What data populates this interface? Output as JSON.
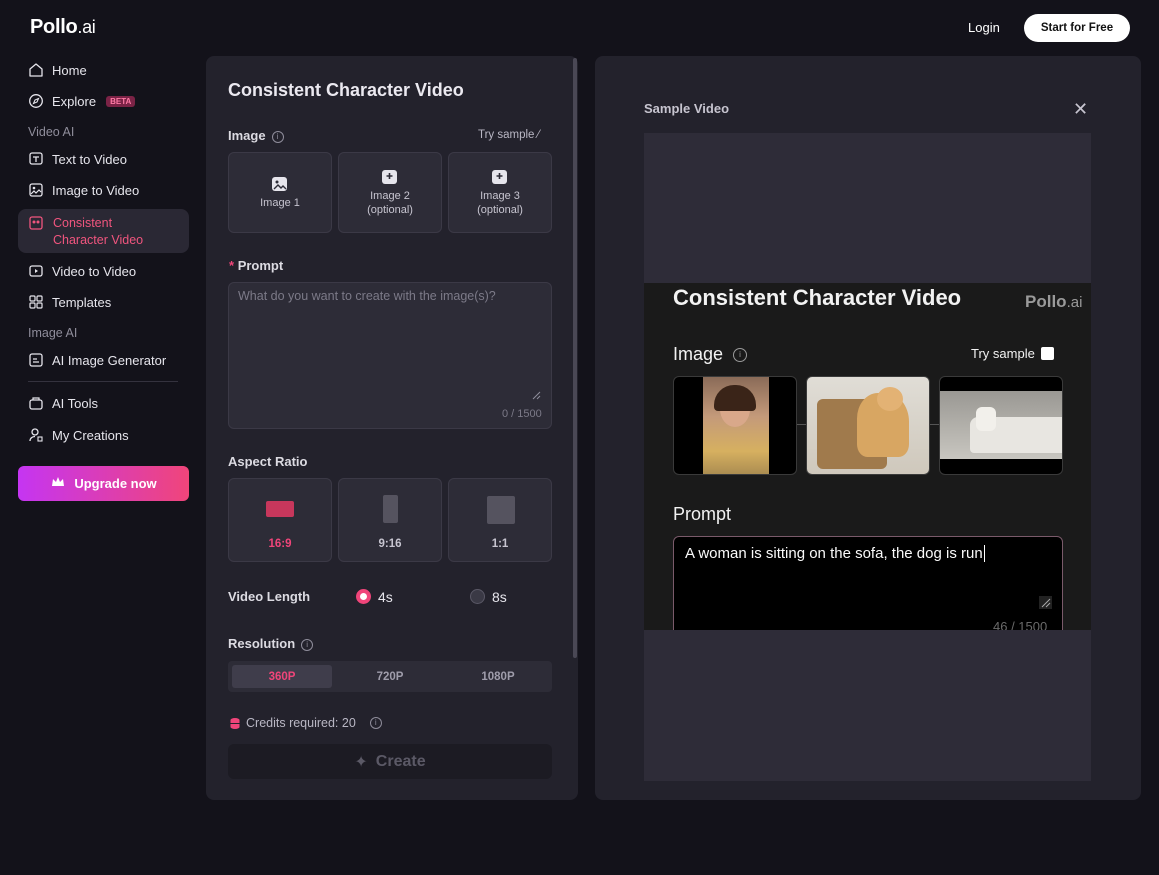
{
  "header": {
    "logo_main": "Pollo",
    "logo_ai": ".ai",
    "login": "Login",
    "start": "Start for Free"
  },
  "sidebar": {
    "home": "Home",
    "explore": "Explore",
    "beta": "BETA",
    "video_ai": "Video AI",
    "text_to_video": "Text to Video",
    "image_to_video": "Image to Video",
    "consistent_line1": "Consistent",
    "consistent_line2": "Character Video",
    "video_to_video": "Video to Video",
    "templates": "Templates",
    "image_ai": "Image AI",
    "ai_image_generator": "AI Image Generator",
    "ai_tools": "AI Tools",
    "my_creations": "My Creations",
    "upgrade": "Upgrade now"
  },
  "form": {
    "title": "Consistent Character Video",
    "image_label": "Image",
    "try_sample": "Try sample",
    "image1": "Image 1",
    "image2": "Image 2",
    "image3": "Image 3",
    "optional": "(optional)",
    "prompt_required": "*",
    "prompt_label": "Prompt",
    "prompt_placeholder": "What do you want to create with the image(s)?",
    "prompt_count": "0 / 1500",
    "aspect_label": "Aspect Ratio",
    "ar_169": "16:9",
    "ar_916": "9:16",
    "ar_11": "1:1",
    "length_label": "Video Length",
    "len_4s": "4s",
    "len_8s": "8s",
    "resolution_label": "Resolution",
    "res_360": "360P",
    "res_720": "720P",
    "res_1080": "1080P",
    "credits": "Credits required: 20",
    "create": "Create"
  },
  "sample": {
    "title": "Sample Video",
    "video_title": "Consistent Character Video",
    "video_logo_main": "Pollo",
    "video_logo_ai": ".ai",
    "video_image": "Image",
    "video_try": "Try sample",
    "video_prompt": "Prompt",
    "video_prompt_text": "A woman is sitting on the sofa, the dog is run",
    "video_count": "46 / 1500"
  },
  "colors": {
    "accent": "#f0457a",
    "background": "#13121a",
    "panel": "#23222c"
  }
}
